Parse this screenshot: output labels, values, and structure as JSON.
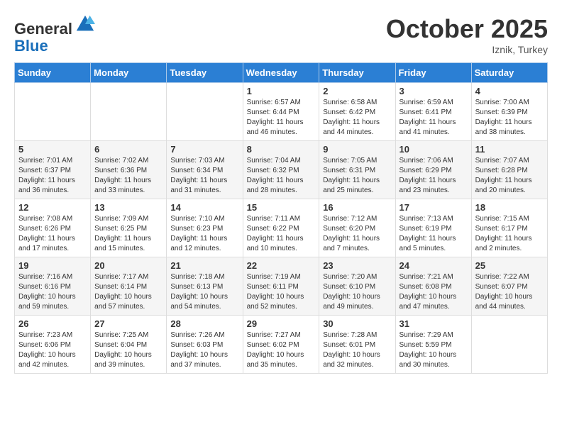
{
  "header": {
    "logo_line1": "General",
    "logo_line2": "Blue",
    "month_title": "October 2025",
    "location": "Iznik, Turkey"
  },
  "weekdays": [
    "Sunday",
    "Monday",
    "Tuesday",
    "Wednesday",
    "Thursday",
    "Friday",
    "Saturday"
  ],
  "weeks": [
    [
      {
        "day": "",
        "info": ""
      },
      {
        "day": "",
        "info": ""
      },
      {
        "day": "",
        "info": ""
      },
      {
        "day": "1",
        "info": "Sunrise: 6:57 AM\nSunset: 6:44 PM\nDaylight: 11 hours\nand 46 minutes."
      },
      {
        "day": "2",
        "info": "Sunrise: 6:58 AM\nSunset: 6:42 PM\nDaylight: 11 hours\nand 44 minutes."
      },
      {
        "day": "3",
        "info": "Sunrise: 6:59 AM\nSunset: 6:41 PM\nDaylight: 11 hours\nand 41 minutes."
      },
      {
        "day": "4",
        "info": "Sunrise: 7:00 AM\nSunset: 6:39 PM\nDaylight: 11 hours\nand 38 minutes."
      }
    ],
    [
      {
        "day": "5",
        "info": "Sunrise: 7:01 AM\nSunset: 6:37 PM\nDaylight: 11 hours\nand 36 minutes."
      },
      {
        "day": "6",
        "info": "Sunrise: 7:02 AM\nSunset: 6:36 PM\nDaylight: 11 hours\nand 33 minutes."
      },
      {
        "day": "7",
        "info": "Sunrise: 7:03 AM\nSunset: 6:34 PM\nDaylight: 11 hours\nand 31 minutes."
      },
      {
        "day": "8",
        "info": "Sunrise: 7:04 AM\nSunset: 6:32 PM\nDaylight: 11 hours\nand 28 minutes."
      },
      {
        "day": "9",
        "info": "Sunrise: 7:05 AM\nSunset: 6:31 PM\nDaylight: 11 hours\nand 25 minutes."
      },
      {
        "day": "10",
        "info": "Sunrise: 7:06 AM\nSunset: 6:29 PM\nDaylight: 11 hours\nand 23 minutes."
      },
      {
        "day": "11",
        "info": "Sunrise: 7:07 AM\nSunset: 6:28 PM\nDaylight: 11 hours\nand 20 minutes."
      }
    ],
    [
      {
        "day": "12",
        "info": "Sunrise: 7:08 AM\nSunset: 6:26 PM\nDaylight: 11 hours\nand 17 minutes."
      },
      {
        "day": "13",
        "info": "Sunrise: 7:09 AM\nSunset: 6:25 PM\nDaylight: 11 hours\nand 15 minutes."
      },
      {
        "day": "14",
        "info": "Sunrise: 7:10 AM\nSunset: 6:23 PM\nDaylight: 11 hours\nand 12 minutes."
      },
      {
        "day": "15",
        "info": "Sunrise: 7:11 AM\nSunset: 6:22 PM\nDaylight: 11 hours\nand 10 minutes."
      },
      {
        "day": "16",
        "info": "Sunrise: 7:12 AM\nSunset: 6:20 PM\nDaylight: 11 hours\nand 7 minutes."
      },
      {
        "day": "17",
        "info": "Sunrise: 7:13 AM\nSunset: 6:19 PM\nDaylight: 11 hours\nand 5 minutes."
      },
      {
        "day": "18",
        "info": "Sunrise: 7:15 AM\nSunset: 6:17 PM\nDaylight: 11 hours\nand 2 minutes."
      }
    ],
    [
      {
        "day": "19",
        "info": "Sunrise: 7:16 AM\nSunset: 6:16 PM\nDaylight: 10 hours\nand 59 minutes."
      },
      {
        "day": "20",
        "info": "Sunrise: 7:17 AM\nSunset: 6:14 PM\nDaylight: 10 hours\nand 57 minutes."
      },
      {
        "day": "21",
        "info": "Sunrise: 7:18 AM\nSunset: 6:13 PM\nDaylight: 10 hours\nand 54 minutes."
      },
      {
        "day": "22",
        "info": "Sunrise: 7:19 AM\nSunset: 6:11 PM\nDaylight: 10 hours\nand 52 minutes."
      },
      {
        "day": "23",
        "info": "Sunrise: 7:20 AM\nSunset: 6:10 PM\nDaylight: 10 hours\nand 49 minutes."
      },
      {
        "day": "24",
        "info": "Sunrise: 7:21 AM\nSunset: 6:08 PM\nDaylight: 10 hours\nand 47 minutes."
      },
      {
        "day": "25",
        "info": "Sunrise: 7:22 AM\nSunset: 6:07 PM\nDaylight: 10 hours\nand 44 minutes."
      }
    ],
    [
      {
        "day": "26",
        "info": "Sunrise: 7:23 AM\nSunset: 6:06 PM\nDaylight: 10 hours\nand 42 minutes."
      },
      {
        "day": "27",
        "info": "Sunrise: 7:25 AM\nSunset: 6:04 PM\nDaylight: 10 hours\nand 39 minutes."
      },
      {
        "day": "28",
        "info": "Sunrise: 7:26 AM\nSunset: 6:03 PM\nDaylight: 10 hours\nand 37 minutes."
      },
      {
        "day": "29",
        "info": "Sunrise: 7:27 AM\nSunset: 6:02 PM\nDaylight: 10 hours\nand 35 minutes."
      },
      {
        "day": "30",
        "info": "Sunrise: 7:28 AM\nSunset: 6:01 PM\nDaylight: 10 hours\nand 32 minutes."
      },
      {
        "day": "31",
        "info": "Sunrise: 7:29 AM\nSunset: 5:59 PM\nDaylight: 10 hours\nand 30 minutes."
      },
      {
        "day": "",
        "info": ""
      }
    ]
  ]
}
